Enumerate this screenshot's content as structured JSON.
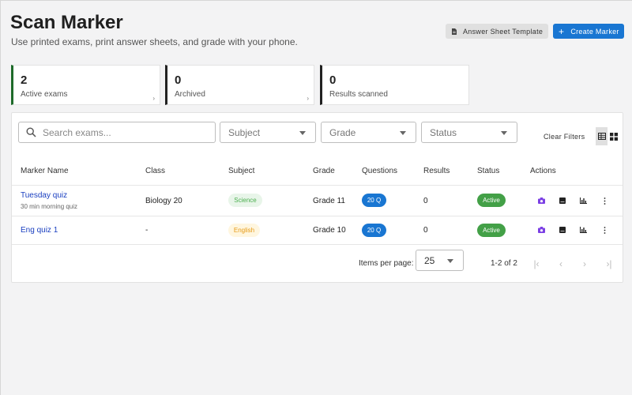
{
  "header": {
    "title": "Scan Marker",
    "subtitle": "Use printed exams, print answer sheets, and grade with your phone.",
    "template_button": "Answer Sheet Template",
    "create_button": "Create Marker"
  },
  "stats": [
    {
      "value": "2",
      "label": "Active exams"
    },
    {
      "value": "0",
      "label": "Archived"
    },
    {
      "value": "0",
      "label": "Results scanned"
    }
  ],
  "filters": {
    "search_placeholder": "Search exams...",
    "subject": "Subject",
    "grade": "Grade",
    "status": "Status",
    "clear": "Clear Filters"
  },
  "table": {
    "columns": [
      "Marker Name",
      "Class",
      "Subject",
      "Grade",
      "Questions",
      "Results",
      "Status",
      "Actions"
    ],
    "rows": [
      {
        "name": "Tuesday quiz",
        "description": "30 min morning quiz",
        "class": "Biology 20",
        "subject": "Science",
        "grade": "Grade 11",
        "questions": "20 Q",
        "results": "0",
        "status": "Active"
      },
      {
        "name": "Eng quiz 1",
        "description": "",
        "class": "-",
        "subject": "English",
        "grade": "Grade 10",
        "questions": "20 Q",
        "results": "0",
        "status": "Active"
      }
    ]
  },
  "pagination": {
    "items_per_page_label": "Items per page:",
    "items_per_page": "25",
    "range": "1-2 of 2"
  },
  "colors": {
    "primary": "#1976d2",
    "active_green": "#43a047",
    "science_text": "#4caf50",
    "english_text": "#e69a16",
    "camera_icon": "#7b3fe4"
  }
}
